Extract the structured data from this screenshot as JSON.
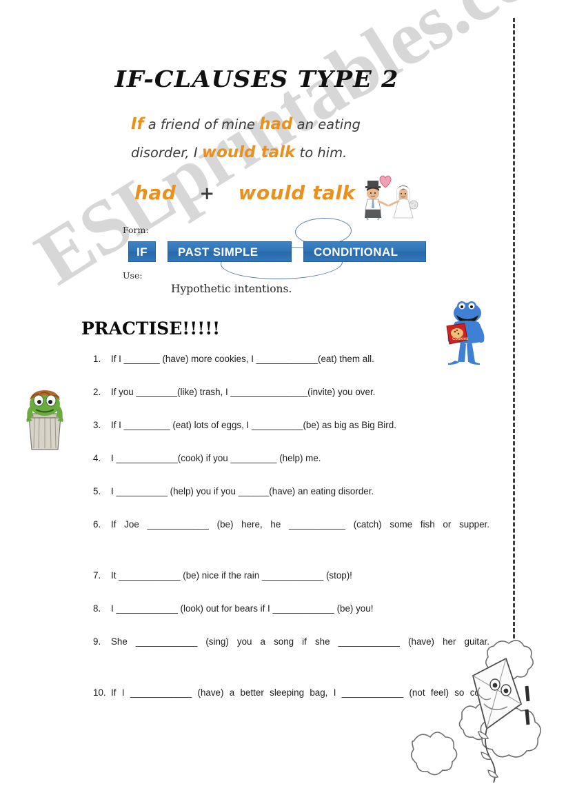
{
  "worksheet": {
    "title": "IF-CLAUSES TYPE 2",
    "example": {
      "line1_if": "If",
      "line1_a": " a friend of mine ",
      "line1_had": "had",
      "line1_b": " an eating",
      "line2_a": "disorder, I ",
      "line2_would": "would talk",
      "line2_b": " to him."
    },
    "formula": {
      "left": "had",
      "operator": "+",
      "right": "would talk"
    },
    "form": {
      "label": "Form:",
      "boxes": [
        "IF",
        "PAST SIMPLE",
        "CONDITIONAL"
      ]
    },
    "use": {
      "label": "Use:",
      "text": "Hypothetic intentions."
    },
    "practise_heading": "PRACTISE!!!!!",
    "exercises": [
      {
        "number": "1.",
        "text": "If I _______ (have) more cookies, I ____________(eat) them all."
      },
      {
        "number": "2.",
        "text": "If you ________(like) trash, I _______________(invite) you over."
      },
      {
        "number": "3.",
        "text": "If I _________ (eat) lots of eggs, I __________(be) as big as Big Bird."
      },
      {
        "number": "4.",
        "text": "I ____________(cook) if you _________ (help) me."
      },
      {
        "number": "5.",
        "text": "I __________ (help) you if you ______(have) an eating disorder."
      },
      {
        "number": "6.",
        "text": "If Joe ____________ (be) here, he ___________ (catch) some fish or supper."
      },
      {
        "number": "7.",
        "text": "It ____________ (be) nice if the rain ____________ (stop)!"
      },
      {
        "number": "8.",
        "text": "I ____________ (look) out for bears if I ____________ (be) you!"
      },
      {
        "number": "9.",
        "text": "She ____________ (sing) you a song if she ____________ (have) her guitar."
      },
      {
        "number": "10.",
        "text": "If I ____________ (have) a better sleeping bag, I ____________ (not feel) so cold."
      }
    ],
    "watermark": "ESLprintables.com",
    "colors": {
      "accent_orange": "#e8911e",
      "box_blue": "#2f73b4",
      "ellipse_blue": "#5b7fa6",
      "watermark_grey": "#c9c9c9"
    }
  }
}
